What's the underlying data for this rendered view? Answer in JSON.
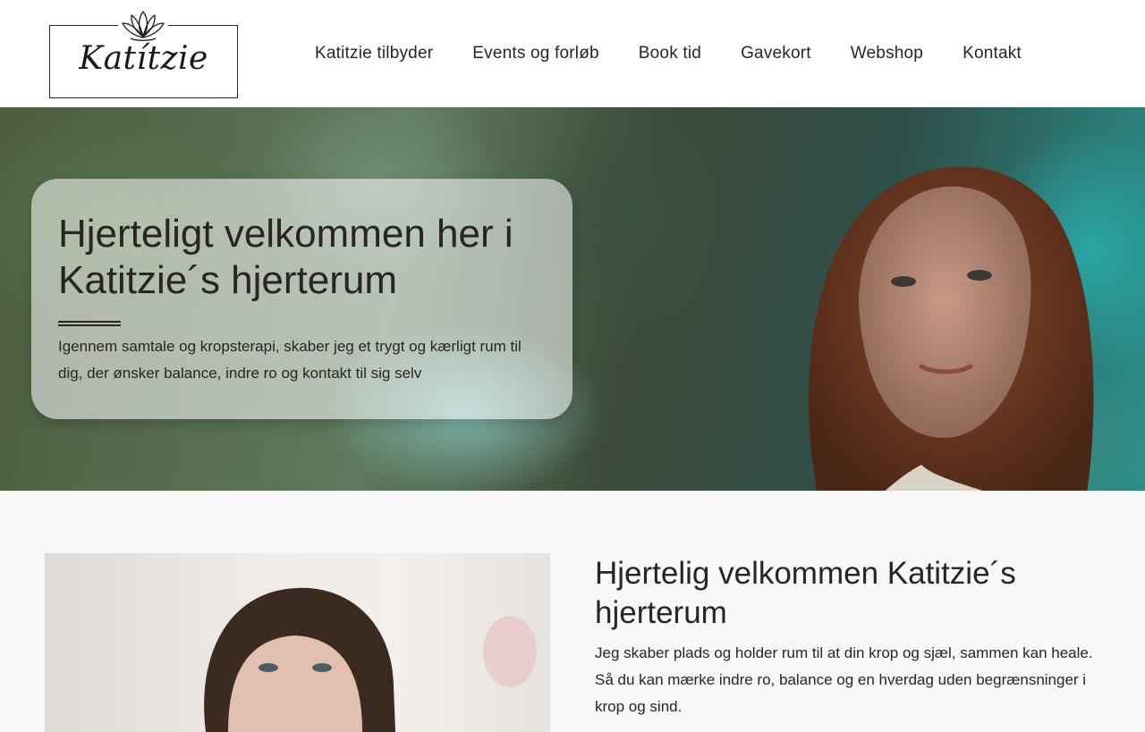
{
  "logo": {
    "text": "Katítzie",
    "icon": "lotus-icon"
  },
  "nav": {
    "items": [
      {
        "label": "Katitzie tilbyder"
      },
      {
        "label": "Events og forløb"
      },
      {
        "label": "Book tid"
      },
      {
        "label": "Gavekort"
      },
      {
        "label": "Webshop"
      },
      {
        "label": "Kontakt"
      }
    ]
  },
  "hero": {
    "title": "Hjerteligt velkommen her i Katitzie´s hjerterum",
    "text": "Igennem samtale og kropsterapi, skaber jeg et trygt og kærligt rum til dig, der ønsker balance, indre ro og kontakt til sig selv"
  },
  "intro": {
    "heading": "Hjertelig velkommen Katitzie´s hjerterum",
    "text": "Jeg skaber plads og holder rum til at din krop og sjæl, sammen kan heale. Så du kan mærke indre ro, balance og en hverdag uden begrænsninger i krop og sind."
  },
  "colors": {
    "text": "#2a2423",
    "header_bg": "#ffffff",
    "page_bg": "#f8f8f8"
  }
}
